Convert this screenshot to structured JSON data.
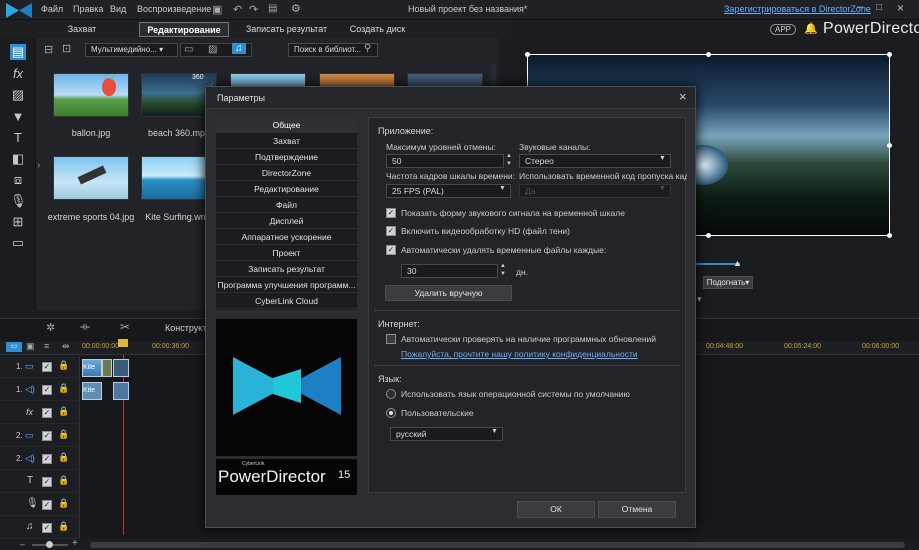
{
  "app": {
    "window_title": "Новый проект без названия*",
    "register_link": "Зарегистрироваться в DirectorZone",
    "app_badge": "APP",
    "brand": "PowerDirector",
    "menu": [
      "Файл",
      "Правка",
      "Вид",
      "Воспроизведение"
    ]
  },
  "modes": [
    "Захват",
    "Редактирование",
    "Записать результат",
    "Создать диск"
  ],
  "library": {
    "filter": "Мультимедийно...",
    "search_placeholder": "Поиск в библиот...",
    "items": [
      {
        "label": "ballon.jpg"
      },
      {
        "label": "beach 360.mp4",
        "badge": "360"
      },
      {
        "label": "extreme sports 04.jpg"
      },
      {
        "label": "Kite Surfing.wmv"
      }
    ]
  },
  "preview": {
    "fit_label": "Подогнать▾"
  },
  "timeline": {
    "tool_label": "Конструкто",
    "times": [
      "00:00:00:00",
      "00:00:36:00",
      "00:04:48:00",
      "00:05:24:00",
      "00:06:00:00"
    ],
    "tracks": [
      "1.",
      "1.",
      "",
      "2.",
      "2.",
      "",
      "",
      ""
    ],
    "clip_labels": [
      "Kite",
      "Kite"
    ]
  },
  "dialog": {
    "title": "Параметры",
    "close_icon": "×",
    "categories": [
      "Общее",
      "Захват",
      "Подтверждение",
      "DirectorZone",
      "Редактирование",
      "Файл",
      "Дисплей",
      "Аппаратное ускорение",
      "Проект",
      "Записать результат",
      "Программа улучшения программ...",
      "CyberLink Cloud"
    ],
    "logo_small": "CyberLink",
    "logo_text": "PowerDirector",
    "logo_version": "15",
    "app_section": {
      "header": "Приложение:",
      "undo_label": "Максимум уровней отмены:",
      "undo_value": "50",
      "audio_label": "Звуковые каналы:",
      "audio_value": "Стерео",
      "fps_label": "Частота кадров шкалы времени:",
      "fps_value": "25 FPS (PAL)",
      "dropframe_label": "Использовать временной код пропуска кадров:",
      "dropframe_value": "Да",
      "cb_waveform": "Показать форму звукового сигнала на временной шкале",
      "cb_hd": "Включить видеообработку HD (файл тени)",
      "cb_autodelete": "Автоматически удалять временные файлы каждые:",
      "days_value": "30",
      "days_unit": "дн.",
      "delete_button": "Удалить вручную"
    },
    "internet_section": {
      "header": "Интернет:",
      "cb_updates": "Автоматически проверять на наличие программных обновлений",
      "privacy_link": "Пожалуйста, прочтите нашу политику конфиденциальности"
    },
    "language_section": {
      "header": "Язык:",
      "radio_system": "Использовать язык операционной системы по умолчанию",
      "radio_custom": "Пользовательские",
      "language_value": "русский"
    },
    "ok": "ОК",
    "cancel": "Отмена"
  },
  "colors": {
    "accent": "#2f8fd0",
    "link": "#6ab0ff",
    "cyan": "#21c7d9"
  }
}
